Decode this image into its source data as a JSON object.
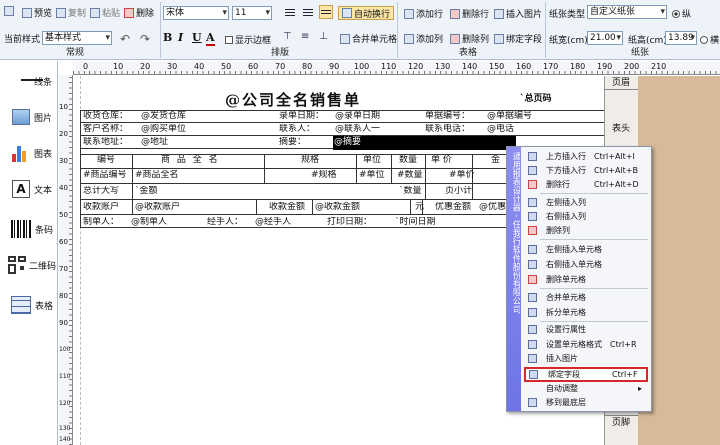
{
  "toolbar": {
    "preview": "预览",
    "copy": "复制",
    "paste": "粘贴",
    "delete": "删除",
    "font_name": "宋体",
    "font_size": "11",
    "current_style_label": "当前样式",
    "current_style": "基本样式",
    "bold": "B",
    "italic": "I",
    "underline": "U",
    "font_color": "A",
    "show_border": "显示边框",
    "auto_wrap": "自动换行",
    "merge_cells": "合并单元格",
    "add_row": "添加行",
    "delete_row": "删除行",
    "insert_image": "插入图片",
    "add_col": "添加列",
    "delete_col": "删除列",
    "bind_field": "绑定字段",
    "paper_type_label": "纸张类型",
    "paper_type": "自定义纸张",
    "portrait": "纵",
    "landscape": "横",
    "paper_width_label": "纸宽(cm)",
    "paper_width": "21.00",
    "paper_height_label": "纸高(cm)",
    "paper_height": "13.89",
    "groups": {
      "general": "常规",
      "layout": "排版",
      "table": "表格",
      "paper": "纸张"
    }
  },
  "left_tools": [
    {
      "label": "线条",
      "icon": "line-icon"
    },
    {
      "label": "图片",
      "icon": "picture-icon"
    },
    {
      "label": "图表",
      "icon": "chart-icon"
    },
    {
      "label": "文本",
      "icon": "text-icon"
    },
    {
      "label": "条码",
      "icon": "barcode-icon"
    },
    {
      "label": "二维码",
      "icon": "qrcode-icon"
    },
    {
      "label": "表格",
      "icon": "table-icon"
    }
  ],
  "ruler": {
    "top": [
      "0",
      "10",
      "20",
      "30",
      "40",
      "50",
      "60",
      "70",
      "80",
      "90",
      "100",
      "110",
      "120",
      "130",
      "140",
      "150",
      "160",
      "170",
      "180",
      "190",
      "200",
      "210"
    ],
    "left": [
      "10",
      "20",
      "30",
      "40",
      "50",
      "60",
      "70",
      "80",
      "90",
      "100",
      "110",
      "120",
      "130",
      "140"
    ]
  },
  "bands": {
    "header": "页眉",
    "table_head": "表头",
    "detail": "明细",
    "footer": "页脚"
  },
  "report": {
    "title": "@公司全名销售单",
    "page_code": "`总页码",
    "rows": [
      [
        "收货仓库：",
        "@发货仓库",
        "录单日期：",
        "@录单日期",
        "单据编号：",
        "@单据编号"
      ],
      [
        "客户名称：",
        "@购买单位",
        "联系人：",
        "@联系人一",
        "联系电话：",
        "@电话"
      ],
      [
        "联系地址：",
        "@地址",
        "摘要：",
        "@摘要"
      ]
    ],
    "columns": [
      "编号",
      "商 品 全 名",
      "规格",
      "单位",
      "数量",
      "单 价",
      "金"
    ],
    "detail": [
      "#商品编号",
      "#商品全名",
      "#规格",
      "#单位",
      "#数量",
      "#单价"
    ],
    "total_label": "总计大写",
    "total_value": "`金额",
    "total_qty": "`数量",
    "subtotal": "页小计",
    "pay": [
      "收款账户",
      "@收款账户",
      "收款金额",
      "@收款金额",
      "元",
      "优惠金额",
      "@优惠"
    ],
    "sign": [
      "制单人：",
      "@制单人",
      "经手人：",
      "@经手人",
      "打印日期：",
      "`时间日期"
    ]
  },
  "context_menu": {
    "side_text": "通用报表设计器 - 任我行软件股份有限公司",
    "items": [
      {
        "label": "上方插入行",
        "shortcut": "Ctrl+Alt+I"
      },
      {
        "label": "下方插入行",
        "shortcut": "Ctrl+Alt+B"
      },
      {
        "label": "删除行",
        "shortcut": "Ctrl+Alt+D"
      },
      {
        "label": "左侧插入列",
        "shortcut": ""
      },
      {
        "label": "右侧插入列",
        "shortcut": ""
      },
      {
        "label": "删除列",
        "shortcut": ""
      },
      {
        "label": "左侧插入单元格",
        "shortcut": ""
      },
      {
        "label": "右侧插入单元格",
        "shortcut": ""
      },
      {
        "label": "删除单元格",
        "shortcut": ""
      },
      {
        "label": "合并单元格",
        "shortcut": ""
      },
      {
        "label": "拆分单元格",
        "shortcut": ""
      },
      {
        "label": "设置行属性",
        "shortcut": ""
      },
      {
        "label": "设置单元格格式",
        "shortcut": "Ctrl+R"
      },
      {
        "label": "插入图片",
        "shortcut": ""
      },
      {
        "label": "绑定字段",
        "shortcut": "Ctrl+F"
      },
      {
        "label": "自动调整",
        "shortcut": "▸"
      },
      {
        "label": "移到最底层",
        "shortcut": ""
      }
    ]
  }
}
